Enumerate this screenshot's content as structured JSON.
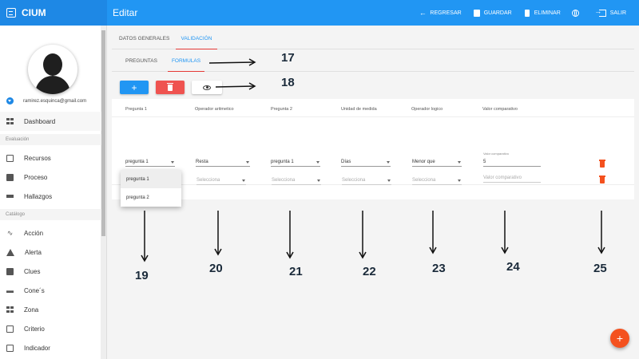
{
  "app": {
    "brand": "CIUM",
    "page_title": "Editar"
  },
  "topbar": {
    "regresar": "REGRESAR",
    "guardar": "GUARDAR",
    "eliminar": "ELIMINAR",
    "salir": "SALIR",
    "icons": [
      "arrow-left-icon",
      "save-icon",
      "trash-icon",
      "globe-icon",
      "exit-icon"
    ]
  },
  "sidebar": {
    "email": "ramirez.esquinca@gmail.com",
    "dashboard": "Dashboard",
    "section_evaluacion": "Evaluación",
    "section_catalogo": "Catálogo",
    "evaluacion_items": [
      "Recursos",
      "Proceso",
      "Hallazgos"
    ],
    "catalogo_items": [
      "Acción",
      "Alerta",
      "Clues",
      "Cone´s",
      "Zona",
      "Criterio",
      "Indicador"
    ]
  },
  "tabs_main": [
    "DATOS GENERALES",
    "VALIDACIÓN"
  ],
  "tabs_sub": [
    "PREGUNTAS",
    "FORMULAS"
  ],
  "table": {
    "headers": [
      "Pregunta 1",
      "Operador aritmetico",
      "Pregunta 2",
      "Unidad de medida",
      "Operador logico",
      "Valor comparativo"
    ],
    "row1": {
      "pregunta1": "pregunta 1",
      "operador": "Resta",
      "pregunta2": "pregunta 1",
      "unidad": "Días",
      "logico": "Menor que",
      "valor_label": "Valor comparativo",
      "valor": "5"
    },
    "row2": {
      "placeholder": "Selecciona",
      "valor_placeholder": "Valor comparativo"
    }
  },
  "dropdown_options": [
    "pregunta 1",
    "pregunta 2"
  ],
  "annotations": [
    "17",
    "18",
    "19",
    "20",
    "21",
    "22",
    "23",
    "24",
    "25"
  ],
  "colors": {
    "primary": "#2196f3",
    "danger": "#ef5350",
    "accent": "#f4511e"
  }
}
